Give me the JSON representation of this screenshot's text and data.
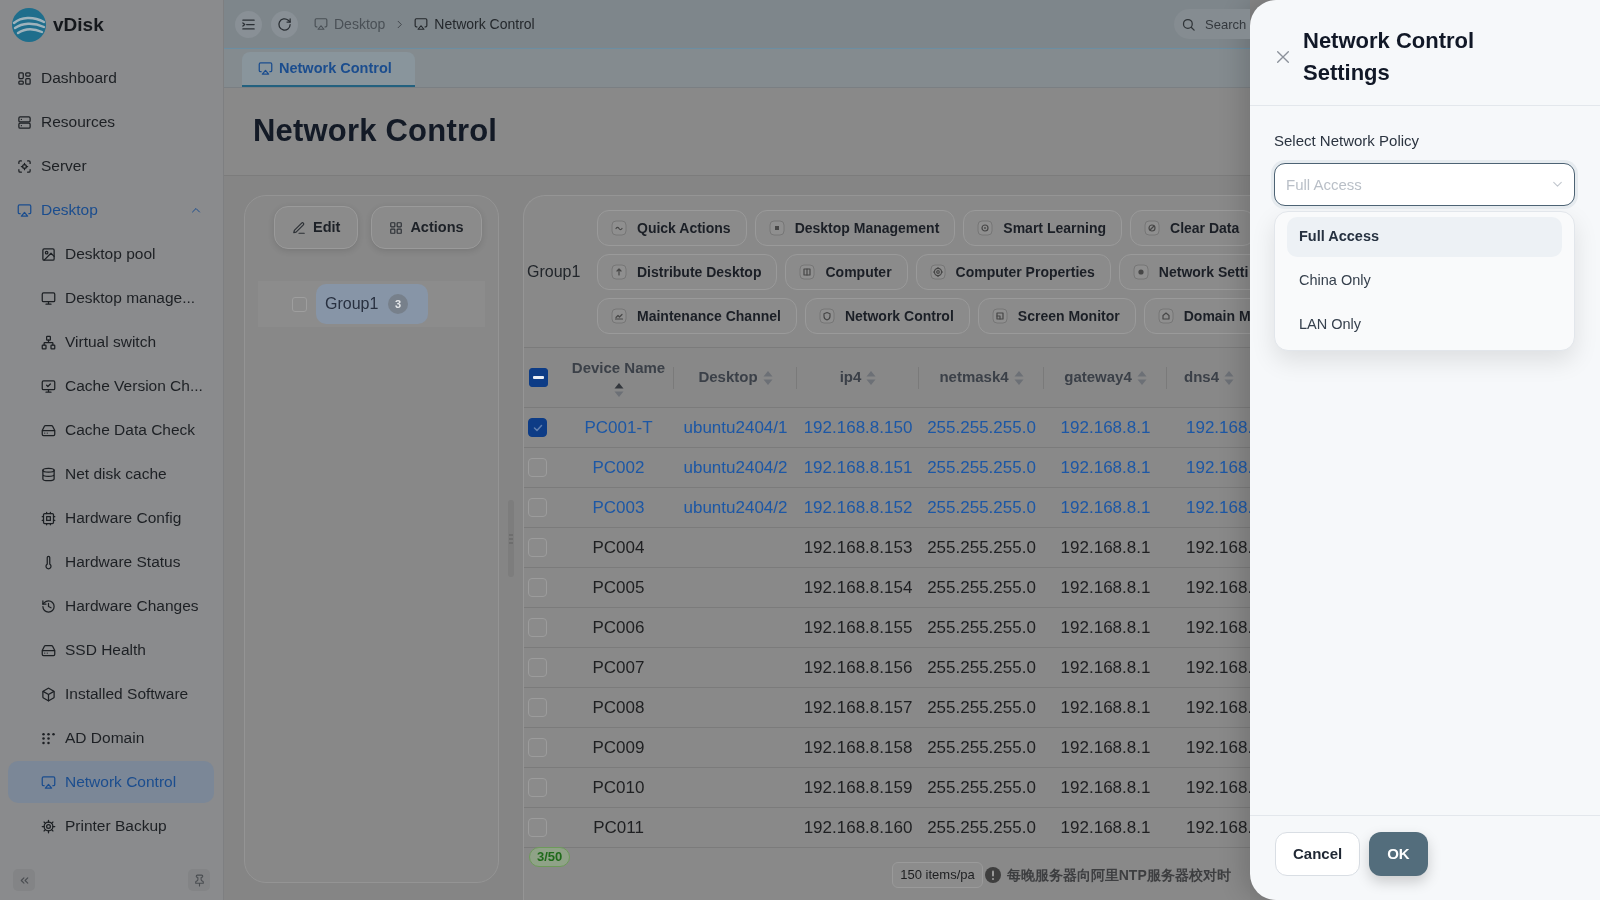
{
  "app": {
    "name": "vDisk"
  },
  "sidebar": {
    "items": [
      {
        "label": "Dashboard",
        "selected": false
      },
      {
        "label": "Resources",
        "selected": false
      },
      {
        "label": "Server",
        "selected": false
      },
      {
        "label": "Desktop",
        "selected": false,
        "expanded": true,
        "children": [
          {
            "label": "Desktop pool",
            "selected": false
          },
          {
            "label": "Desktop manage...",
            "selected": false
          },
          {
            "label": "Virtual switch",
            "selected": false
          },
          {
            "label": "Cache Version Ch...",
            "selected": false
          },
          {
            "label": "Cache Data Check",
            "selected": false
          },
          {
            "label": "Net disk cache",
            "selected": false
          },
          {
            "label": "Hardware Config",
            "selected": false
          },
          {
            "label": "Hardware Status",
            "selected": false
          },
          {
            "label": "Hardware Changes",
            "selected": false
          },
          {
            "label": "SSD Health",
            "selected": false
          },
          {
            "label": "Installed Software",
            "selected": false
          },
          {
            "label": "AD Domain",
            "selected": false
          },
          {
            "label": "Network Control",
            "selected": true
          },
          {
            "label": "Printer Backup",
            "selected": false
          }
        ]
      }
    ]
  },
  "top_bar": {
    "breadcrumb": [
      "Desktop",
      "Network Control"
    ],
    "search": {
      "placeholder": "Search"
    }
  },
  "tabs": [
    {
      "label": "Network Control",
      "selected": true
    }
  ],
  "page_title": "Network Control",
  "group_panel": {
    "buttons": [
      "Edit",
      "Actions"
    ],
    "tree": [
      {
        "label": "Group1",
        "count": "3",
        "checked": false,
        "selected": true
      }
    ]
  },
  "device_panel": {
    "group_label": "Group1",
    "action_rows": [
      {
        "buttons": [
          "Quick Actions",
          "Desktop Management",
          "Smart Learning",
          "Clear Data"
        ]
      },
      {
        "buttons": [
          "Distribute Desktop",
          "Computer",
          "Computer Properties",
          "Network Setti"
        ]
      },
      {
        "buttons": [
          "Maintenance Channel",
          "Network Control",
          "Screen Monitor",
          "Domain M"
        ]
      }
    ],
    "table": {
      "select_all": {
        "indeterminate": true
      },
      "columns": [
        {
          "label": "Device Name",
          "sorted_ascending": true
        },
        {
          "label": "Desktop",
          "sorted_ascending": false
        },
        {
          "label": "ip4",
          "sorted_ascending": false
        },
        {
          "label": "netmask4",
          "sorted_ascending": false
        },
        {
          "label": "gateway4",
          "sorted_ascending": false
        },
        {
          "label": "dns4",
          "sorted_ascending": false
        }
      ],
      "rows": [
        {
          "checked": true,
          "highlighted": true,
          "device_name": "PC001-T",
          "desktop": "ubuntu2404/1",
          "ip4": "192.168.8.150",
          "netmask4": "255.255.255.0",
          "gateway4": "192.168.8.1",
          "dns4": "192.168."
        },
        {
          "checked": false,
          "highlighted": true,
          "device_name": "PC002",
          "desktop": "ubuntu2404/2",
          "ip4": "192.168.8.151",
          "netmask4": "255.255.255.0",
          "gateway4": "192.168.8.1",
          "dns4": "192.168."
        },
        {
          "checked": false,
          "highlighted": true,
          "device_name": "PC003",
          "desktop": "ubuntu2404/2",
          "ip4": "192.168.8.152",
          "netmask4": "255.255.255.0",
          "gateway4": "192.168.8.1",
          "dns4": "192.168."
        },
        {
          "checked": false,
          "highlighted": false,
          "device_name": "PC004",
          "ip4": "192.168.8.153",
          "netmask4": "255.255.255.0",
          "gateway4": "192.168.8.1",
          "dns4": "192.168."
        },
        {
          "checked": false,
          "highlighted": false,
          "device_name": "PC005",
          "ip4": "192.168.8.154",
          "netmask4": "255.255.255.0",
          "gateway4": "192.168.8.1",
          "dns4": "192.168."
        },
        {
          "checked": false,
          "highlighted": false,
          "device_name": "PC006",
          "ip4": "192.168.8.155",
          "netmask4": "255.255.255.0",
          "gateway4": "192.168.8.1",
          "dns4": "192.168."
        },
        {
          "checked": false,
          "highlighted": false,
          "device_name": "PC007",
          "ip4": "192.168.8.156",
          "netmask4": "255.255.255.0",
          "gateway4": "192.168.8.1",
          "dns4": "192.168."
        },
        {
          "checked": false,
          "highlighted": false,
          "device_name": "PC008",
          "ip4": "192.168.8.157",
          "netmask4": "255.255.255.0",
          "gateway4": "192.168.8.1",
          "dns4": "192.168."
        },
        {
          "checked": false,
          "highlighted": false,
          "device_name": "PC009",
          "ip4": "192.168.8.158",
          "netmask4": "255.255.255.0",
          "gateway4": "192.168.8.1",
          "dns4": "192.168."
        },
        {
          "checked": false,
          "highlighted": false,
          "device_name": "PC010",
          "ip4": "192.168.8.159",
          "netmask4": "255.255.255.0",
          "gateway4": "192.168.8.1",
          "dns4": "192.168."
        },
        {
          "checked": false,
          "highlighted": false,
          "device_name": "PC011",
          "ip4": "192.168.8.160",
          "netmask4": "255.255.255.0",
          "gateway4": "192.168.8.1",
          "dns4": "192.168."
        }
      ]
    },
    "selection_count": "3/50",
    "page_size": "150 items/pa",
    "notice": "每晚服务器向阿里NTP服务器校对时"
  },
  "drawer": {
    "title": "Network Control Settings",
    "field_label": "Select Network Policy",
    "select": {
      "placeholder": "Full Access",
      "expanded": true
    },
    "options": [
      {
        "label": "Full Access",
        "selected": true
      },
      {
        "label": "China Only",
        "selected": false
      },
      {
        "label": "LAN Only",
        "selected": false
      }
    ],
    "buttons": [
      {
        "label": "Cancel",
        "kind": "secondary"
      },
      {
        "label": "OK",
        "kind": "primary"
      }
    ]
  }
}
